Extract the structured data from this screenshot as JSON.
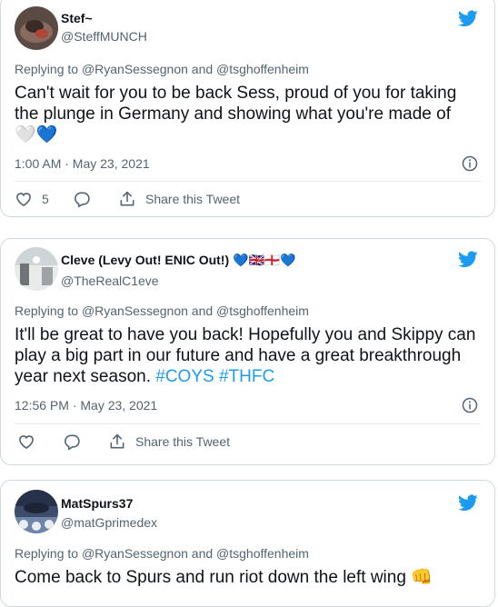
{
  "tweets": [
    {
      "name": "Stef~",
      "handle": "@SteffMUNCH",
      "replying_prefix": "Replying to",
      "reply_to_1": "@RyanSessegnon",
      "reply_and": "and",
      "reply_to_2": "@tsghoffenheim",
      "text": "Can't wait for you to be back Sess, proud of you for taking the plunge in Germany and showing what you're made of",
      "emoji": "🤍💙",
      "timestamp": "1:00 AM · May 23, 2021",
      "like_count": "5",
      "share_label": "Share this Tweet"
    },
    {
      "name": "Cleve (Levy Out! ENIC Out!)",
      "name_emoji": "💙🇬🇧🏴󠁧󠁢󠁥󠁮󠁧󠁿💙",
      "handle": "@TheRealC1eve",
      "replying_prefix": "Replying to",
      "reply_to_1": "@RyanSessegnon",
      "reply_and": "and",
      "reply_to_2": "@tsghoffenheim",
      "text": "It'll be great to have you back! Hopefully you and Skippy can play a big part in our future and have a great breakthrough year next season.",
      "hashtag_1": "#COYS",
      "hashtag_2": "#THFC",
      "timestamp": "12:56 PM · May 23, 2021",
      "share_label": "Share this Tweet"
    },
    {
      "name": "MatSpurs37",
      "handle": "@matGprimedex",
      "replying_prefix": "Replying to",
      "reply_to_1": "@RyanSessegnon",
      "reply_and": "and",
      "reply_to_2": "@tsghoffenheim",
      "text": "Come back to Spurs and run riot down the left wing",
      "emoji": "👊"
    }
  ],
  "colors": {
    "accent": "#1d9bf0",
    "secondary_text": "#536471",
    "border": "#cfd9de"
  },
  "icons": [
    "twitter-bird-icon",
    "info-icon",
    "heart-icon",
    "reply-icon",
    "share-icon"
  ]
}
